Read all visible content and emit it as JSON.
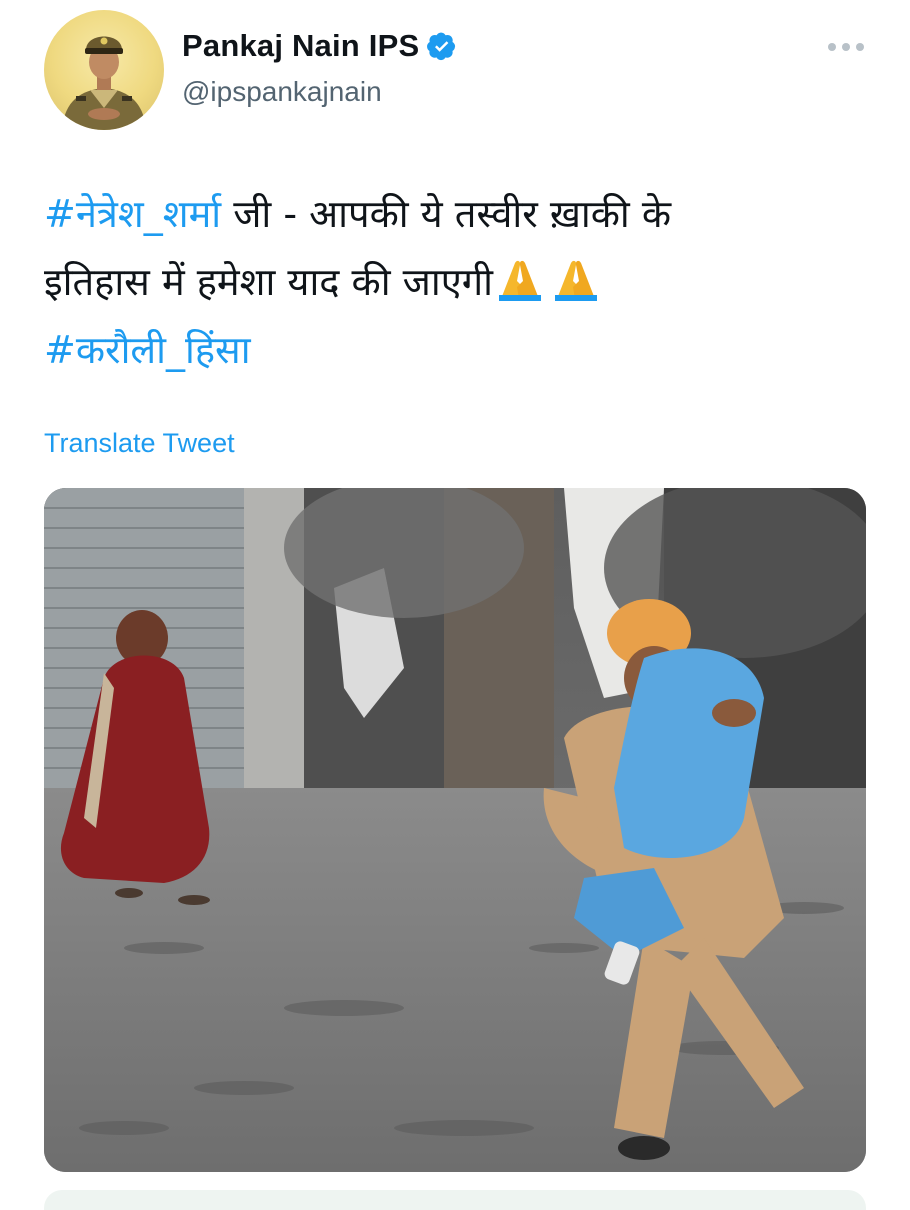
{
  "tweet": {
    "author": {
      "display_name": "Pankaj Nain IPS",
      "handle": "@ipspankajnain",
      "verified": true,
      "avatar_icon": "police-officer-avatar"
    },
    "text_lines": [
      {
        "hashtag": "#नेत्रेश_शर्मा",
        "text": " जी - आपकी ये तस्वीर ख़ाकी के"
      },
      {
        "text": "इतिहास में हमेशा याद की जाएगी"
      },
      {
        "hashtag": "#करौली_हिंसा"
      }
    ],
    "emojis": [
      "folded-hands",
      "folded-hands"
    ],
    "translate_label": "Translate Tweet",
    "media_description_icon": "photo"
  },
  "colors": {
    "accent": "#1d9bf0",
    "text": "#0f1419",
    "secondary_text": "#536471",
    "verified_badge": "#1d9bf0"
  }
}
